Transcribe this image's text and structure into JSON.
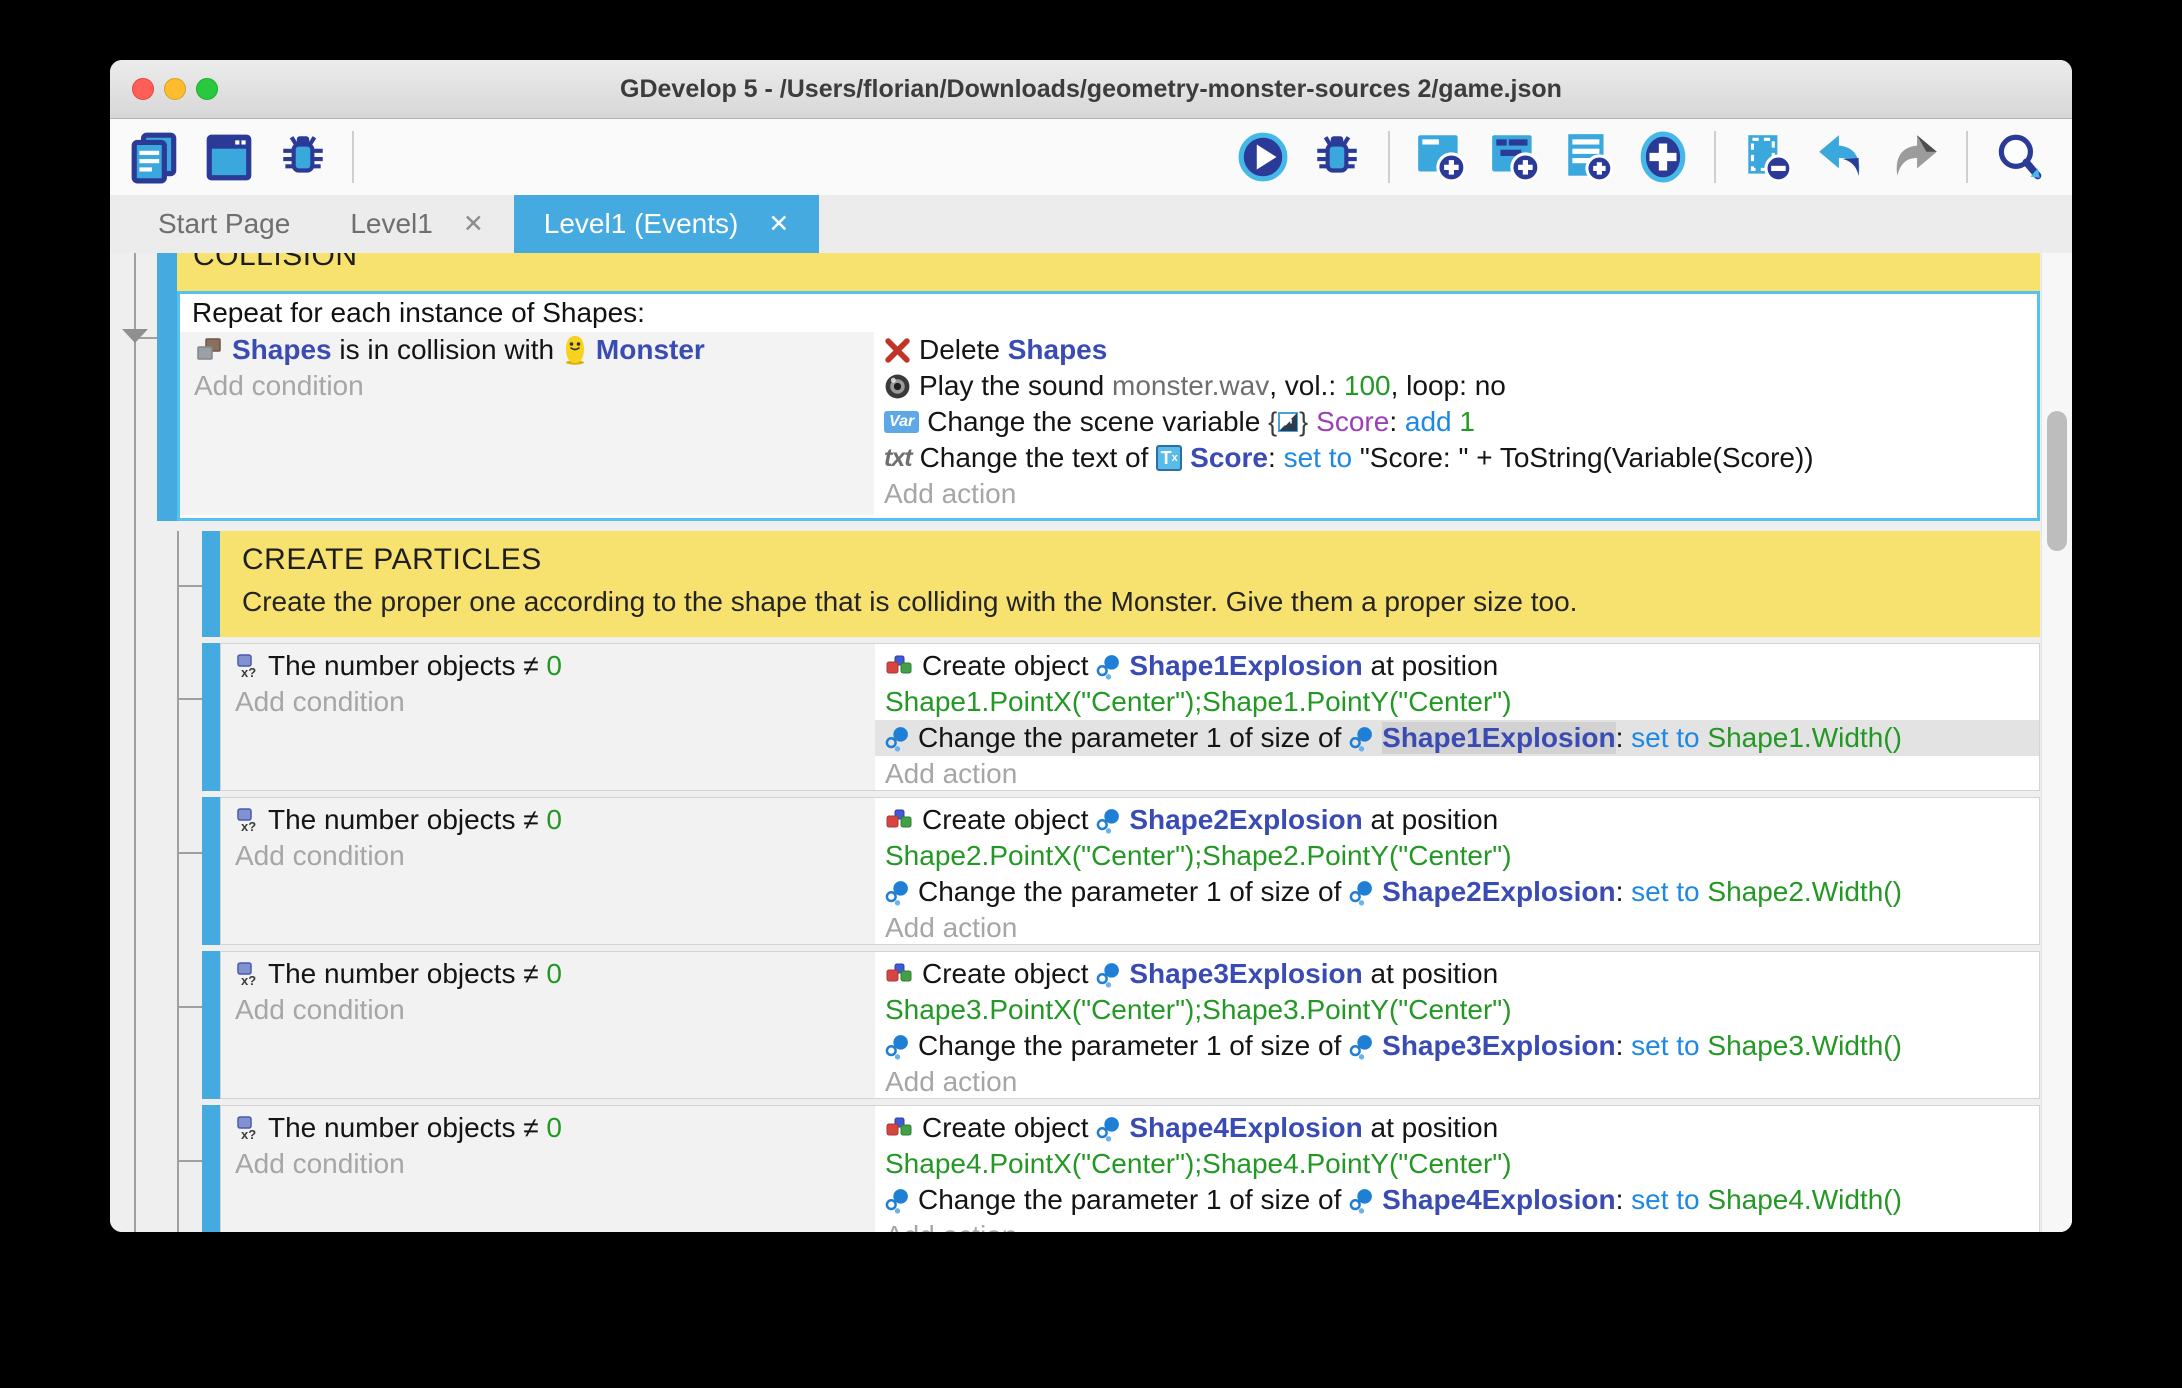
{
  "window": {
    "title": "GDevelop 5 - /Users/florian/Downloads/geometry-monster-sources 2/game.json"
  },
  "colors": {
    "accent_blue": "#45AADF",
    "selection_border": "#57C2F0",
    "comment_yellow": "#F8E26F",
    "object_name_indigo": "#3A4CB4",
    "expression_green": "#249824",
    "keyword_blue": "#1E88E5",
    "variable_purple": "#9C3FB5"
  },
  "toolbar": {
    "left": [
      "project-manager-icon",
      "scene-editor-icon",
      "debugger-icon"
    ],
    "right": [
      "play-icon",
      "debugger-icon",
      "sep",
      "add-event-icon",
      "add-subevent-icon",
      "add-comment-icon",
      "add-plus-icon",
      "sep",
      "remove-selection-icon",
      "undo-icon",
      "redo-icon",
      "sep",
      "search-icon"
    ]
  },
  "tabs": [
    {
      "label": "Start Page",
      "active": false,
      "closable": false
    },
    {
      "label": "Level1",
      "active": false,
      "closable": true
    },
    {
      "label": "Level1 (Events)",
      "active": true,
      "closable": true
    }
  ],
  "sheet": {
    "collision_header": "COLLISION",
    "repeat_event": {
      "header": "Repeat for each instance of Shapes:",
      "conditions": [
        [
          {
            "icon": "shapes-icon"
          },
          {
            "s": "o",
            "t": "Shapes"
          },
          {
            "s": "b",
            "t": " is in collision with "
          },
          {
            "icon": "monster-icon"
          },
          {
            "s": "o",
            "t": "Monster"
          }
        ]
      ],
      "add_condition": "Add condition",
      "actions": [
        [
          {
            "icon": "delete-icon"
          },
          {
            "s": "b",
            "t": "Delete "
          },
          {
            "s": "o",
            "t": "Shapes"
          }
        ],
        [
          {
            "icon": "sound-icon"
          },
          {
            "s": "b",
            "t": "Play the sound "
          },
          {
            "s": "f",
            "t": "monster.wav"
          },
          {
            "s": "b",
            "t": ", vol.: "
          },
          {
            "s": "g",
            "t": "100"
          },
          {
            "s": "b",
            "t": ", loop: "
          },
          {
            "s": "b",
            "t": "no"
          }
        ],
        [
          {
            "icon": "var-icon"
          },
          {
            "s": "b",
            "t": "Change the scene variable "
          },
          {
            "icon": "scene-var-icon"
          },
          {
            "s": "p",
            "t": "Score"
          },
          {
            "s": "b",
            "t": ": "
          },
          {
            "s": "k",
            "t": "add "
          },
          {
            "s": "g",
            "t": "1"
          }
        ],
        [
          {
            "icon": "txt-icon"
          },
          {
            "s": "b",
            "t": "Change the text of "
          },
          {
            "icon": "text-object-icon"
          },
          {
            "s": "o",
            "t": "Score"
          },
          {
            "s": "b",
            "t": ": "
          },
          {
            "s": "k",
            "t": "set to "
          },
          {
            "s": "b",
            "t": "\"Score: \" + ToString(Variable(Score))"
          }
        ]
      ],
      "add_action": "Add action"
    },
    "comment": {
      "title": "CREATE PARTICLES",
      "description": "Create the proper one according to the shape that is colliding with the Monster. Give them a proper size too."
    },
    "shape_events": [
      {
        "conditions": [
          [
            {
              "icon": "number-objects-icon"
            },
            {
              "s": "b",
              "t": "The number objects "
            },
            {
              "s": "b",
              "t": "≠ "
            },
            {
              "s": "g",
              "t": "0"
            }
          ]
        ],
        "add_condition": "Add condition",
        "actions": [
          [
            {
              "icon": "create-object-icon"
            },
            {
              "s": "b",
              "t": "Create object "
            },
            {
              "icon": "particle-icon"
            },
            {
              "s": "o",
              "t": "Shape1Explosion"
            },
            {
              "s": "b",
              "t": " at position"
            }
          ],
          [
            {
              "s": "g",
              "t": "Shape1.PointX(\"Center\");Shape1.PointY(\"Center\")"
            }
          ],
          [
            {
              "icon": "particle-icon"
            },
            {
              "s": "b",
              "t": "Change the parameter 1 of size of "
            },
            {
              "icon": "particle-icon"
            },
            {
              "s": "oh",
              "t": "Shape1Explosion"
            },
            {
              "s": "b",
              "t": ": "
            },
            {
              "s": "k",
              "t": "set to "
            },
            {
              "s": "g",
              "t": "Shape1.Width()"
            }
          ]
        ],
        "highlight_action_index": 2,
        "add_action": "Add action"
      },
      {
        "conditions": [
          [
            {
              "icon": "number-objects-icon"
            },
            {
              "s": "b",
              "t": "The number objects "
            },
            {
              "s": "b",
              "t": "≠ "
            },
            {
              "s": "g",
              "t": "0"
            }
          ]
        ],
        "add_condition": "Add condition",
        "actions": [
          [
            {
              "icon": "create-object-icon"
            },
            {
              "s": "b",
              "t": "Create object "
            },
            {
              "icon": "particle-icon"
            },
            {
              "s": "o",
              "t": "Shape2Explosion"
            },
            {
              "s": "b",
              "t": " at position"
            }
          ],
          [
            {
              "s": "g",
              "t": "Shape2.PointX(\"Center\");Shape2.PointY(\"Center\")"
            }
          ],
          [
            {
              "icon": "particle-icon"
            },
            {
              "s": "b",
              "t": "Change the parameter 1 of size of "
            },
            {
              "icon": "particle-icon"
            },
            {
              "s": "o",
              "t": "Shape2Explosion"
            },
            {
              "s": "b",
              "t": ": "
            },
            {
              "s": "k",
              "t": "set to "
            },
            {
              "s": "g",
              "t": "Shape2.Width()"
            }
          ]
        ],
        "highlight_action_index": -1,
        "add_action": "Add action"
      },
      {
        "conditions": [
          [
            {
              "icon": "number-objects-icon"
            },
            {
              "s": "b",
              "t": "The number objects "
            },
            {
              "s": "b",
              "t": "≠ "
            },
            {
              "s": "g",
              "t": "0"
            }
          ]
        ],
        "add_condition": "Add condition",
        "actions": [
          [
            {
              "icon": "create-object-icon"
            },
            {
              "s": "b",
              "t": "Create object "
            },
            {
              "icon": "particle-icon"
            },
            {
              "s": "o",
              "t": "Shape3Explosion"
            },
            {
              "s": "b",
              "t": " at position"
            }
          ],
          [
            {
              "s": "g",
              "t": "Shape3.PointX(\"Center\");Shape3.PointY(\"Center\")"
            }
          ],
          [
            {
              "icon": "particle-icon"
            },
            {
              "s": "b",
              "t": "Change the parameter 1 of size of "
            },
            {
              "icon": "particle-icon"
            },
            {
              "s": "o",
              "t": "Shape3Explosion"
            },
            {
              "s": "b",
              "t": ": "
            },
            {
              "s": "k",
              "t": "set to "
            },
            {
              "s": "g",
              "t": "Shape3.Width()"
            }
          ]
        ],
        "highlight_action_index": -1,
        "add_action": "Add action"
      },
      {
        "conditions": [
          [
            {
              "icon": "number-objects-icon"
            },
            {
              "s": "b",
              "t": "The number objects "
            },
            {
              "s": "b",
              "t": "≠ "
            },
            {
              "s": "g",
              "t": "0"
            }
          ]
        ],
        "add_condition": "Add condition",
        "actions": [
          [
            {
              "icon": "create-object-icon"
            },
            {
              "s": "b",
              "t": "Create object "
            },
            {
              "icon": "particle-icon"
            },
            {
              "s": "o",
              "t": "Shape4Explosion"
            },
            {
              "s": "b",
              "t": " at position"
            }
          ],
          [
            {
              "s": "g",
              "t": "Shape4.PointX(\"Center\");Shape4.PointY(\"Center\")"
            }
          ],
          [
            {
              "icon": "particle-icon"
            },
            {
              "s": "b",
              "t": "Change the parameter 1 of size of "
            },
            {
              "icon": "particle-icon"
            },
            {
              "s": "o",
              "t": "Shape4Explosion"
            },
            {
              "s": "b",
              "t": ": "
            },
            {
              "s": "k",
              "t": "set to "
            },
            {
              "s": "g",
              "t": "Shape4.Width()"
            }
          ]
        ],
        "highlight_action_index": -1,
        "add_action": "Add action"
      }
    ]
  }
}
